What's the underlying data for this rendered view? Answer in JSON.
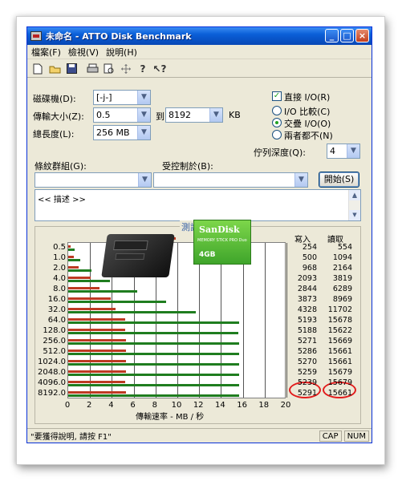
{
  "window": {
    "title": "未命名 - ATTO Disk Benchmark",
    "controls": [
      "_",
      "□",
      "×"
    ]
  },
  "menu": [
    "檔案(F)",
    "檢視(V)",
    "說明(H)"
  ],
  "toolbar_icons": [
    "new-file-icon",
    "open-folder-icon",
    "save-icon",
    "print-icon",
    "print-preview-icon",
    "move-icon",
    "help-icon",
    "context-help-icon"
  ],
  "form": {
    "drive_label": "磁碟機(D):",
    "drive_value": "[-j-]",
    "transfer_label": "傳輸大小(Z):",
    "transfer_from": "0.5",
    "to_label": "到",
    "transfer_to": "8192",
    "kb_label": "KB",
    "total_label": "總長度(L):",
    "total_value": "256 MB",
    "direct_io_label": "直接 I/O(R)",
    "direct_io_checked": true,
    "io_compare_label": "I/O 比較(C)",
    "overlap_io_label": "交疊 I/O(O)",
    "neither_label": "兩者都不(N)",
    "queue_label": "佇列深度(Q):",
    "queue_value": "4",
    "controlled_group_label": "條紋群組(G):",
    "controlled_by_label": "受控制於(B):",
    "start_button": "開始(S)",
    "description": "<< 描述 >>"
  },
  "results": {
    "title": "測試結果",
    "legend_write": "寫入",
    "legend_read": "讀取",
    "col_write": "寫入",
    "col_read": "讀取",
    "x_axis_title": "傳輸速率 - MB / 秒",
    "write_color": "#bd3a22",
    "read_color": "#1f7d1f"
  },
  "chart_data": {
    "type": "bar",
    "orientation": "horizontal",
    "categories": [
      "0.5",
      "1.0",
      "2.0",
      "4.0",
      "8.0",
      "16.0",
      "32.0",
      "64.0",
      "128.0",
      "256.0",
      "512.0",
      "1024.0",
      "2048.0",
      "4096.0",
      "8192.0"
    ],
    "series": [
      {
        "name": "寫入",
        "values": [
          254,
          500,
          968,
          2093,
          2844,
          3873,
          4328,
          5193,
          5188,
          5271,
          5286,
          5270,
          5259,
          5239,
          5291
        ]
      },
      {
        "name": "讀取",
        "values": [
          554,
          1094,
          2164,
          3819,
          6289,
          8969,
          11702,
          15678,
          15622,
          15669,
          15661,
          15661,
          15679,
          15679,
          15661
        ]
      }
    ],
    "x_ticks": [
      "0",
      "2",
      "4",
      "6",
      "8",
      "10",
      "12",
      "14",
      "16",
      "18",
      "20"
    ],
    "xlim": [
      0,
      20
    ],
    "xlabel": "傳輸速率 - MB / 秒",
    "value_unit_divisor": 1000,
    "grid": true,
    "legend": "top"
  },
  "status": {
    "text": "\"要獲得說明, 請按 F1\"",
    "cap": "CAP",
    "num": "NUM"
  }
}
